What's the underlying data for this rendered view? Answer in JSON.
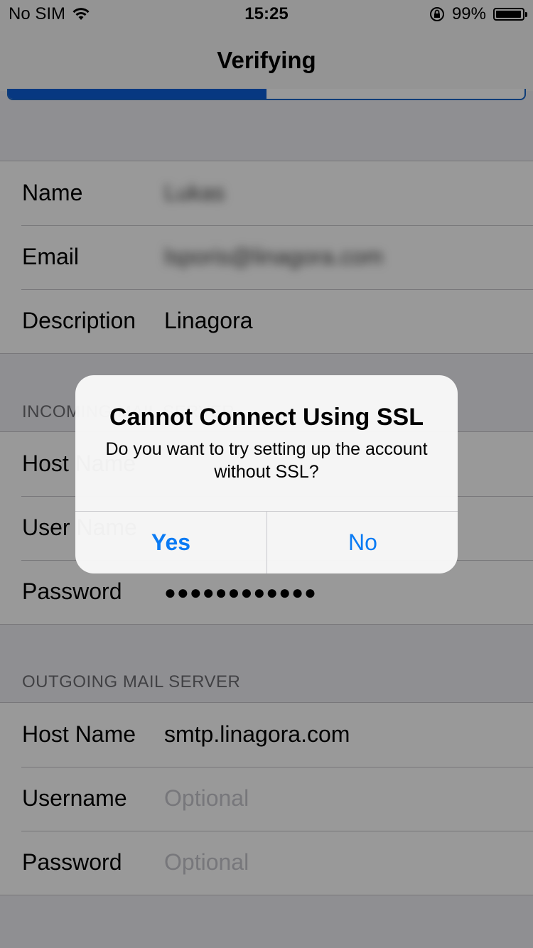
{
  "status_bar": {
    "carrier": "No SIM",
    "time": "15:25",
    "battery": "99%"
  },
  "nav": {
    "title": "Verifying",
    "progress": 0.5
  },
  "account": {
    "name_label": "Name",
    "name_value": "Lukas",
    "email_label": "Email",
    "email_value": "lsporis@linagora.com",
    "description_label": "Description",
    "description_value": "Linagora"
  },
  "incoming": {
    "header": "INCOMING MAIL SERVER",
    "host_label": "Host Name",
    "username_label": "User Name",
    "password_label": "Password",
    "password_value": "●●●●●●●●●●●●"
  },
  "outgoing": {
    "header": "OUTGOING MAIL SERVER",
    "host_label": "Host Name",
    "host_value": "smtp.linagora.com",
    "username_label": "Username",
    "username_placeholder": "Optional",
    "password_label": "Password",
    "password_placeholder": "Optional"
  },
  "alert": {
    "title": "Cannot Connect Using SSL",
    "message": "Do you want to try setting up the account without SSL?",
    "yes": "Yes",
    "no": "No"
  }
}
